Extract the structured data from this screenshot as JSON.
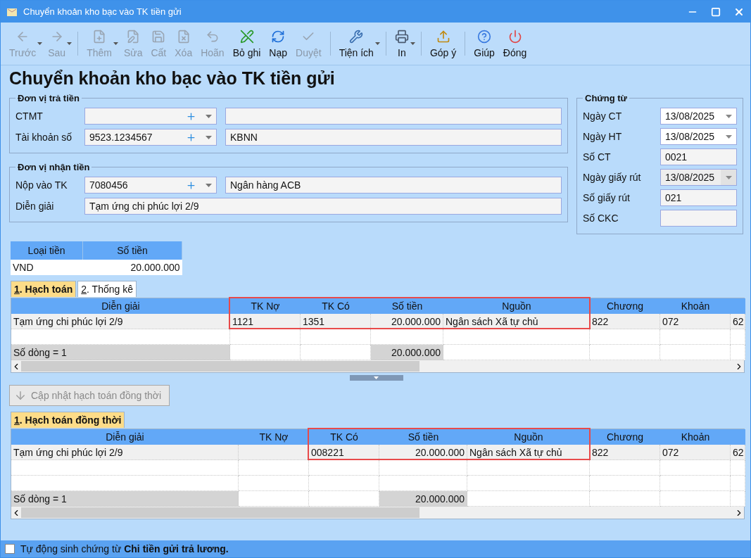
{
  "window": {
    "title": "Chuyển khoản kho bạc vào TK tiền gửi"
  },
  "toolbar": [
    {
      "kind": "button",
      "label": "Trước",
      "disabled": true,
      "dropdown": true
    },
    {
      "kind": "button",
      "label": "Sau",
      "disabled": true,
      "dropdown": true
    },
    {
      "kind": "separator"
    },
    {
      "kind": "button",
      "label": "Thêm",
      "disabled": true,
      "dropdown": true
    },
    {
      "kind": "button",
      "label": "Sửa",
      "disabled": true,
      "dropdown": false
    },
    {
      "kind": "button",
      "label": "Cất",
      "disabled": true,
      "dropdown": false
    },
    {
      "kind": "button",
      "label": "Xóa",
      "disabled": true,
      "dropdown": false
    },
    {
      "kind": "button",
      "label": "Hoãn",
      "disabled": true,
      "dropdown": false
    },
    {
      "kind": "button",
      "label": "Bỏ ghi",
      "disabled": false,
      "dropdown": false
    },
    {
      "kind": "button",
      "label": "Nạp",
      "disabled": false,
      "dropdown": false
    },
    {
      "kind": "button",
      "label": "Duyệt",
      "disabled": true,
      "dropdown": false
    },
    {
      "kind": "separator"
    },
    {
      "kind": "button",
      "label": "Tiện ích",
      "disabled": false,
      "dropdown": true
    },
    {
      "kind": "separator"
    },
    {
      "kind": "button",
      "label": "In",
      "disabled": false,
      "dropdown": true
    },
    {
      "kind": "separator"
    },
    {
      "kind": "button",
      "label": "Góp ý",
      "disabled": false,
      "dropdown": false
    },
    {
      "kind": "separator"
    },
    {
      "kind": "button",
      "label": "Giúp",
      "disabled": false,
      "dropdown": false
    },
    {
      "kind": "button",
      "label": "Đóng",
      "disabled": false,
      "dropdown": false
    }
  ],
  "heading": "Chuyển khoản kho bạc vào TK tiền gửi",
  "payer": {
    "legend": "Đơn vị trả tiền",
    "rows": [
      {
        "kind": "combo",
        "label": "CTMT"
      },
      {
        "kind": "combo",
        "label": "Tài khoản số",
        "value": "9523.1234567",
        "name": "KBNN"
      }
    ]
  },
  "payee": {
    "legend": "Đơn vị nhận tiền",
    "rows": [
      {
        "kind": "combo",
        "label": "Nộp vào TK",
        "value": "7080456",
        "name": "Ngân hàng ACB"
      },
      {
        "kind": "text",
        "label": "Diễn giải",
        "value": "Tạm ứng chi phúc lợi 2/9"
      }
    ]
  },
  "voucher": {
    "legend": "Chứng từ",
    "fields": [
      {
        "kind": "date",
        "label": "Ngày CT",
        "value": "13/08/2025",
        "disabled": false
      },
      {
        "kind": "date",
        "label": "Ngày HT",
        "value": "13/08/2025",
        "disabled": false
      },
      {
        "kind": "text",
        "label": "Số CT",
        "value": "0021"
      },
      {
        "kind": "date",
        "label": "Ngày giấy rút",
        "value": "13/08/2025",
        "disabled": true
      },
      {
        "kind": "text",
        "label": "Số giấy rút",
        "value": "021"
      },
      {
        "kind": "text",
        "label": "Số CKC"
      }
    ]
  },
  "currency": {
    "columns": [
      "Loại tiền",
      "Số tiền"
    ],
    "rows": [
      [
        "VND",
        "20.000.000"
      ]
    ]
  },
  "grids": [
    {
      "tabs": [
        {
          "hotkey": "1",
          "label": ". Hạch toán",
          "selected": true
        },
        {
          "hotkey": "2",
          "label": ". Thống kê",
          "selected": false
        }
      ],
      "columns": [
        {
          "title": "Diễn giải",
          "highlighted": false
        },
        {
          "title": "TK Nợ",
          "highlighted": true
        },
        {
          "title": "TK Có",
          "highlighted": true
        },
        {
          "title": "Số tiền",
          "highlighted": true
        },
        {
          "title": "Nguồn",
          "highlighted": true
        },
        {
          "title": "Chương",
          "highlighted": false
        },
        {
          "title": "Khoản",
          "highlighted": false
        },
        {
          "highlighted": false
        }
      ],
      "rows": [
        {
          "kind": "data",
          "cells": [
            "Tạm ứng chi phúc lợi 2/9",
            "1121",
            "1351",
            "20.000.000",
            "Ngân sách Xã tự chủ",
            "822",
            "072",
            "62"
          ]
        },
        {
          "kind": "blank"
        }
      ],
      "footer": {
        "label": "Số dòng = 1",
        "total": "20.000.000"
      }
    },
    {
      "tabs": [
        {
          "hotkey": "1",
          "label": ". Hạch toán đồng thời",
          "selected": true
        }
      ],
      "columns": [
        {
          "title": "Diễn giải",
          "highlighted": false
        },
        {
          "title": "TK Nợ",
          "highlighted": false
        },
        {
          "title": "TK Có",
          "highlighted": true
        },
        {
          "title": "Số tiền",
          "highlighted": true
        },
        {
          "title": "Nguồn",
          "highlighted": true
        },
        {
          "title": "Chương",
          "highlighted": false
        },
        {
          "title": "Khoản",
          "highlighted": false
        },
        {
          "highlighted": false
        }
      ],
      "rows": [
        {
          "kind": "data",
          "cells": [
            "Tạm ứng chi phúc lợi 2/9",
            "",
            "008221",
            "20.000.000",
            "Ngân sách Xã tự chủ",
            "822",
            "072",
            "62"
          ]
        },
        {
          "kind": "blank"
        },
        {
          "kind": "blank"
        }
      ],
      "footer": {
        "label": "Số dòng = 1",
        "total": "20.000.000"
      }
    }
  ],
  "update_button": {
    "label": "Cập nhật hạch toán đồng thời",
    "disabled": true
  },
  "status": {
    "checked": false,
    "text": "Tự động sinh chứng từ **Chi tiền gửi trả lương.**"
  }
}
